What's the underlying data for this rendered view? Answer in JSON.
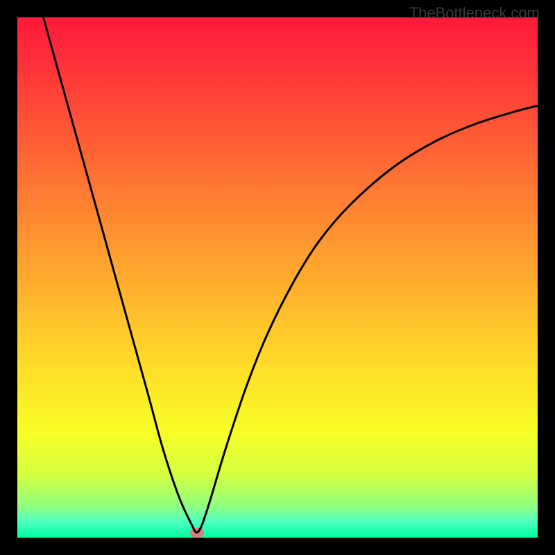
{
  "watermark": "TheBottleneck.com",
  "chart_data": {
    "type": "line",
    "title": "",
    "xlabel": "",
    "ylabel": "",
    "xlim": [
      0,
      100
    ],
    "ylim": [
      0,
      100
    ],
    "grid": false,
    "series": [
      {
        "name": "bottleneck-curve",
        "x": [
          5,
          10,
          15,
          20,
          25,
          28,
          31,
          33.5,
          34.5,
          35.5,
          37,
          40,
          44,
          48,
          53,
          58,
          64,
          72,
          80,
          88,
          96,
          100
        ],
        "values": [
          100,
          82,
          64,
          46,
          28,
          17,
          8,
          2.5,
          1,
          2.5,
          7,
          17,
          29,
          39,
          49,
          57,
          64,
          71,
          76,
          79.5,
          82,
          83
        ]
      }
    ],
    "marker": {
      "x": 34.5,
      "y": 1
    },
    "colors": {
      "curve": "#000000",
      "marker": "#d88080",
      "gradient_top": "#ff1a3a",
      "gradient_mid": "#ffdf29",
      "gradient_bottom": "#00ff99"
    }
  }
}
